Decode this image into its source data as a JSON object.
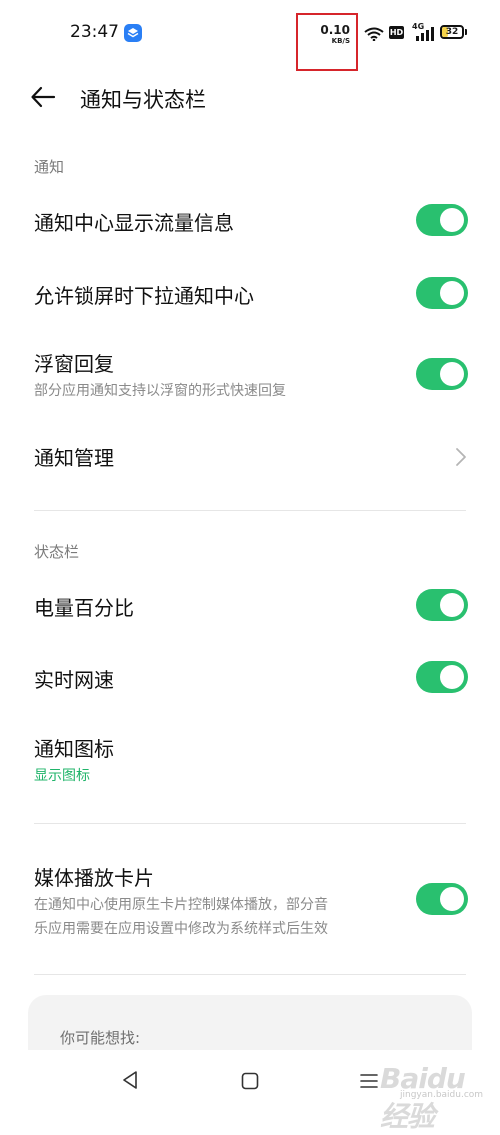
{
  "status_bar": {
    "time": "23:47",
    "net_speed_value": "0.10",
    "net_speed_unit": "KB/S",
    "hd_label": "HD",
    "network_type": "4G",
    "battery": "32",
    "highlight_color": "#d6252b"
  },
  "header": {
    "title": "通知与状态栏"
  },
  "sections": {
    "notifications": {
      "title": "通知",
      "rows": [
        {
          "title": "通知中心显示流量信息",
          "toggle": true
        },
        {
          "title": "允许锁屏时下拉通知中心",
          "toggle": true
        },
        {
          "title": "浮窗回复",
          "subtitle": "部分应用通知支持以浮窗的形式快速回复",
          "toggle": true
        },
        {
          "title": "通知管理"
        }
      ]
    },
    "status_bar": {
      "title": "状态栏",
      "rows": [
        {
          "title": "电量百分比",
          "toggle": true
        },
        {
          "title": "实时网速",
          "toggle": true
        },
        {
          "title": "通知图标",
          "subtitle": "显示图标"
        }
      ]
    },
    "media": {
      "rows": [
        {
          "title": "媒体播放卡片",
          "subtitle_line1": "在通知中心使用原生卡片控制媒体播放，部分音",
          "subtitle_line2": "乐应用需要在应用设置中修改为系统样式后生效",
          "toggle": true
        }
      ]
    }
  },
  "suggestions": {
    "title": "你可能想找:"
  },
  "watermark": {
    "brand": "Baidu 经验",
    "url": "jingyan.baidu.com"
  },
  "colors": {
    "accent": "#29c06f",
    "accent_text": "#20b46a"
  }
}
